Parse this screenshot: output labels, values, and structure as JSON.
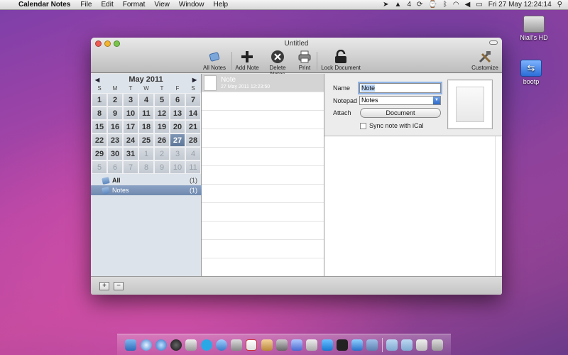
{
  "menubar": {
    "app_name": "Calendar Notes",
    "menus": [
      "File",
      "Edit",
      "Format",
      "View",
      "Window",
      "Help"
    ],
    "battery_text": "4",
    "datetime": "Fri 27 May  12:24:14"
  },
  "desktop": {
    "icons": [
      {
        "label": "Niall's HD"
      },
      {
        "label": "bootp"
      }
    ]
  },
  "window": {
    "title": "Untitled",
    "toolbar": {
      "all_notes": "All Notes",
      "add_note": "Add Note",
      "delete_notes": "Delete Notes",
      "print": "Print",
      "lock_document": "Lock Document",
      "customize": "Customize"
    },
    "calendar": {
      "month_label": "May 2011",
      "dow": [
        "S",
        "M",
        "T",
        "W",
        "T",
        "F",
        "S"
      ],
      "weeks": [
        [
          "1",
          "2",
          "3",
          "4",
          "5",
          "6",
          "7"
        ],
        [
          "8",
          "9",
          "10",
          "11",
          "12",
          "13",
          "14"
        ],
        [
          "15",
          "16",
          "17",
          "18",
          "19",
          "20",
          "21"
        ],
        [
          "22",
          "23",
          "24",
          "25",
          "26",
          "27",
          "28"
        ],
        [
          "29",
          "30",
          "31",
          "1",
          "2",
          "3",
          "4"
        ],
        [
          "5",
          "6",
          "7",
          "8",
          "9",
          "10",
          "11"
        ]
      ],
      "today": "27"
    },
    "sources": [
      {
        "label": "All",
        "count": "(1)"
      },
      {
        "label": "Notes",
        "count": "(1)"
      }
    ],
    "notes": [
      {
        "title": "Note",
        "date": "27 May 2011 12:23:50"
      }
    ],
    "details": {
      "name_label": "Name",
      "name_value": "Note",
      "notepad_label": "Notepad",
      "notepad_value": "Notes",
      "attach_label": "Attach",
      "attach_button": "Document",
      "sync_label": "Sync note with iCal"
    },
    "bottom": {
      "add": "+",
      "remove": "−"
    }
  }
}
